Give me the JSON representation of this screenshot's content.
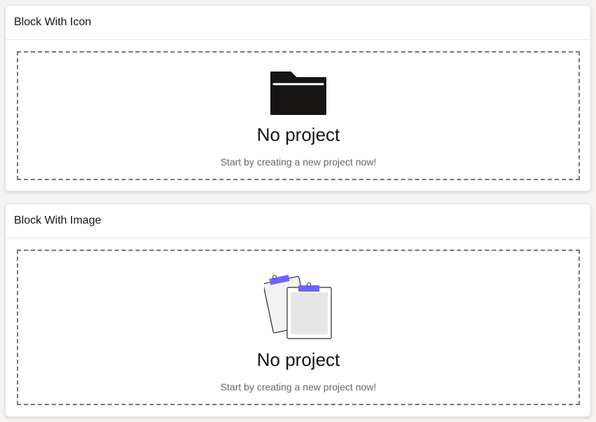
{
  "cards": [
    {
      "title": "Block With Icon",
      "icon": "folder-icon",
      "heading": "No project",
      "message": "Start by creating a new project now!"
    },
    {
      "title": "Block With Image",
      "image": "clipboards-illustration",
      "heading": "No project",
      "message": "Start by creating a new project now!"
    }
  ],
  "colors": {
    "accent": "#6c63ff",
    "icon": "#161513",
    "border_dash": "#7a7673"
  }
}
